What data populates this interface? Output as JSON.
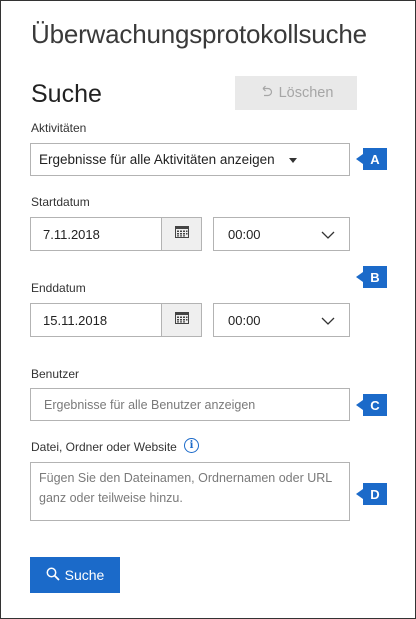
{
  "header": {
    "title": "Überwachungsprotokollsuche"
  },
  "search": {
    "title": "Suche",
    "clear_label": "Löschen",
    "submit_label": "Suche"
  },
  "activities": {
    "label": "Aktivitäten",
    "selected": "Ergebnisse für alle Aktivitäten anzeigen"
  },
  "start": {
    "label": "Startdatum",
    "date": "7.11.2018",
    "time": "00:00"
  },
  "end": {
    "label": "Enddatum",
    "date": "15.11.2018",
    "time": "00:00"
  },
  "users": {
    "label": "Benutzer",
    "placeholder": "Ergebnisse für alle Benutzer anzeigen"
  },
  "file": {
    "label": "Datei, Ordner oder Website",
    "placeholder": "Fügen Sie den Dateinamen, Ordnernamen oder URL ganz oder teilweise hinzu."
  },
  "callouts": {
    "a": "A",
    "b": "B",
    "c": "C",
    "d": "D"
  },
  "icons": {
    "undo": "undo-icon",
    "calendar": "calendar-icon",
    "chevron": "chevron-down-icon",
    "info": "info-icon",
    "search": "search-icon"
  },
  "colors": {
    "accent": "#1b6ac9",
    "disabled_bg": "#e9e9e9",
    "disabled_text": "#a6a6a6",
    "border": "#b3b3b3"
  }
}
